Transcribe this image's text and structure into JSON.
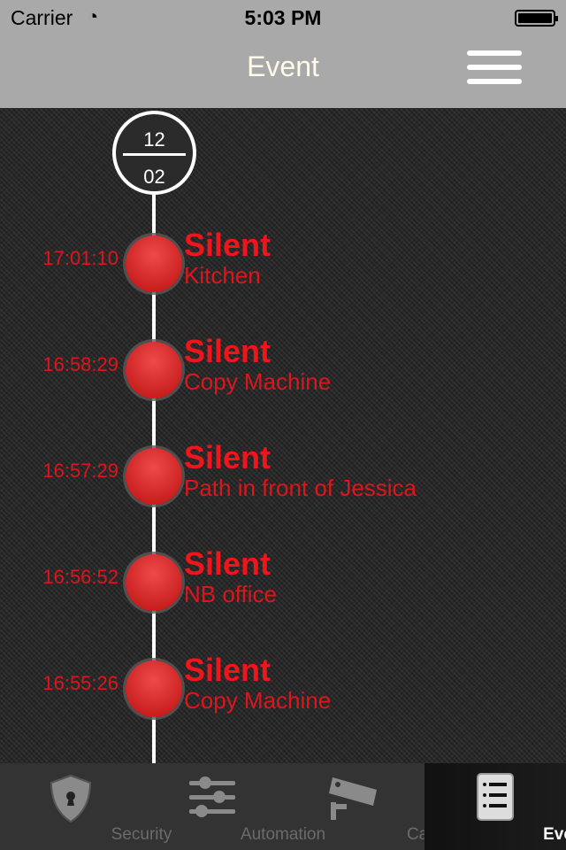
{
  "status_bar": {
    "carrier": "Carrier",
    "time": "5:03 PM"
  },
  "nav": {
    "title": "Event",
    "menu_icon": "hamburger-menu-icon"
  },
  "timeline": {
    "date_month": "12",
    "date_day": "02",
    "events": [
      {
        "time": "17:01:10",
        "type": "Silent",
        "location": "Kitchen"
      },
      {
        "time": "16:58:29",
        "type": "Silent",
        "location": "Copy Machine"
      },
      {
        "time": "16:57:29",
        "type": "Silent",
        "location": "Path in front of Jessica"
      },
      {
        "time": "16:56:52",
        "type": "Silent",
        "location": "NB office"
      },
      {
        "time": "16:55:26",
        "type": "Silent",
        "location": "Copy Machine"
      }
    ]
  },
  "tabs": [
    {
      "label": "Security",
      "icon": "shield-lock-icon"
    },
    {
      "label": "Automation",
      "icon": "sliders-icon"
    },
    {
      "label": "Cam",
      "icon": "security-camera-icon"
    },
    {
      "label": "Event",
      "icon": "list-icon",
      "active": true
    }
  ],
  "colors": {
    "accent": "#e0141b",
    "nav": "#a9a9a9"
  }
}
